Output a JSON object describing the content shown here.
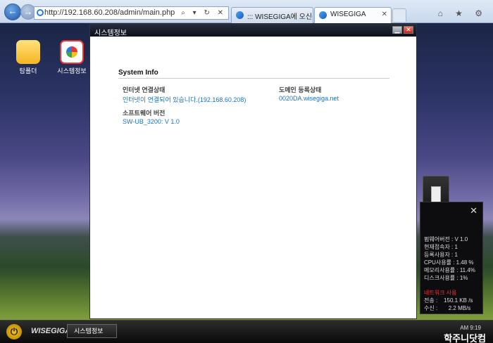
{
  "browser": {
    "url": "http://192.168.60.208/admin/main.php",
    "address_icons": "⌕ ▾ ↻ ✕",
    "tabs": [
      {
        "label": "::: WISEGIGA에 오신것을 환영..."
      },
      {
        "label": "WISEGIGA",
        "close": "✕"
      }
    ],
    "right_icons": "⌂ ★ ⚙"
  },
  "desktop": {
    "icons": [
      {
        "label": "탐폴더"
      },
      {
        "label": "시스템정보"
      }
    ]
  },
  "window": {
    "title": "시스템정보",
    "section_title": "System Info",
    "internet_label": "인터넷 연결상태",
    "internet_value": "인터넷이 연결되어 있습니다.(192.168.60.208)",
    "domain_label": "도메인 등록상태",
    "domain_value": "0020DA.wisegiga.net",
    "software_label": "소프트웨어 버전",
    "software_value": "SW-UB_3200: V 1.0"
  },
  "widget": {
    "firmware": "펌웨어버전 : V 1.0",
    "current_users": "현재접속자 : 1",
    "registered_users": "등록사용자 : 1",
    "cpu": "CPU사용률 : 1.48 %",
    "memory": "메모리사용률 : 11.4%",
    "disk": "디스크사용률 : 1%",
    "network_title": "네트워크 사용",
    "send": "전송 :    150.1 KB /s",
    "receive": "수신 :       2.2 MB/s"
  },
  "taskbar": {
    "brand": "WISEGIGA",
    "task_label": "시스템정보",
    "clock": "AM 9:19",
    "watermark": "학주니닷컴"
  }
}
